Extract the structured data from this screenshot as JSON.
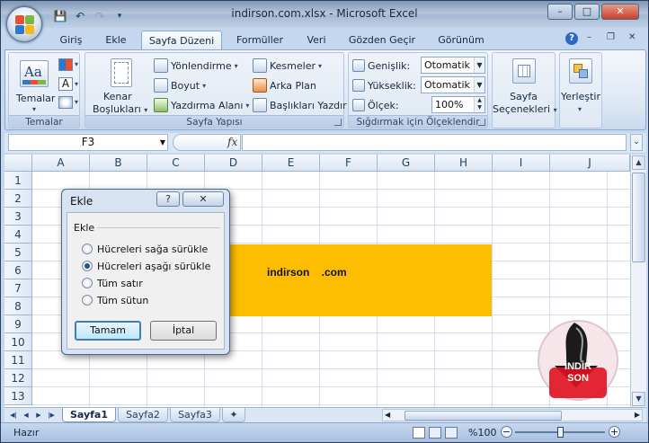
{
  "window": {
    "title": "indirson.com.xlsx - Microsoft Excel",
    "controls": [
      "–",
      "□",
      "✕"
    ]
  },
  "qat": {
    "icons": [
      "save-icon",
      "undo-icon",
      "redo-icon",
      "customize-icon"
    ]
  },
  "tabs": [
    "Giriş",
    "Ekle",
    "Sayfa Düzeni",
    "Formüller",
    "Veri",
    "Gözden Geçir",
    "Görünüm"
  ],
  "active_tab": "Sayfa Düzeni",
  "ribbon": {
    "temalar": {
      "label": "Temalar",
      "button": "Temalar"
    },
    "sayfa_yapisi": {
      "label": "Sayfa Yapısı",
      "kenar": "Kenar",
      "bosluklari": "Boşlukları",
      "yonlendirme": "Yönlendirme",
      "boyut": "Boyut",
      "yazdirma_alani": "Yazdırma Alanı",
      "kesmeler": "Kesmeler",
      "arka_plan": "Arka Plan",
      "basliklari_yazdir": "Başlıkları Yazdır"
    },
    "sigdirmak": {
      "label": "Sığdırmak için Ölçeklendir",
      "genislik_label": "Genişlik:",
      "genislik_value": "Otomatik",
      "yukseklik_label": "Yükseklik:",
      "yukseklik_value": "Otomatik",
      "olcek_label": "Ölçek:",
      "olcek_value": "100%"
    },
    "sayfa_secenekleri": {
      "line1": "Sayfa",
      "line2": "Seçenekleri"
    },
    "yerlestir": {
      "label": "Yerleştir"
    }
  },
  "formula_bar": {
    "name_box": "F3",
    "fx": "fx",
    "content": ""
  },
  "grid": {
    "columns": [
      "A",
      "B",
      "C",
      "D",
      "E",
      "F",
      "G",
      "H",
      "I",
      "J"
    ],
    "rows": [
      "1",
      "2",
      "3",
      "4",
      "5",
      "6",
      "7",
      "8",
      "9",
      "10",
      "11",
      "12",
      "13"
    ],
    "merged_text": "indirson    .com",
    "fill_color": "#fdbd00"
  },
  "sheets": {
    "tabs": [
      "Sayfa1",
      "Sayfa2",
      "Sayfa3"
    ],
    "active": "Sayfa1"
  },
  "status": {
    "text": "Hazır",
    "zoom": "%100",
    "zoom_minus": "−",
    "zoom_plus": "+"
  },
  "dialog": {
    "title": "Ekle",
    "group_label": "Ekle",
    "help": "?",
    "close": "✕",
    "options": [
      "Hücreleri sağa sürükle",
      "Hücreleri aşağı sürükle",
      "Tüm satır",
      "Tüm sütun"
    ],
    "selected": "Hücreleri aşağı sürükle",
    "ok": "Tamam",
    "cancel": "İptal"
  },
  "watermark": {
    "line1": "İNDİR",
    "line2": "SON"
  }
}
